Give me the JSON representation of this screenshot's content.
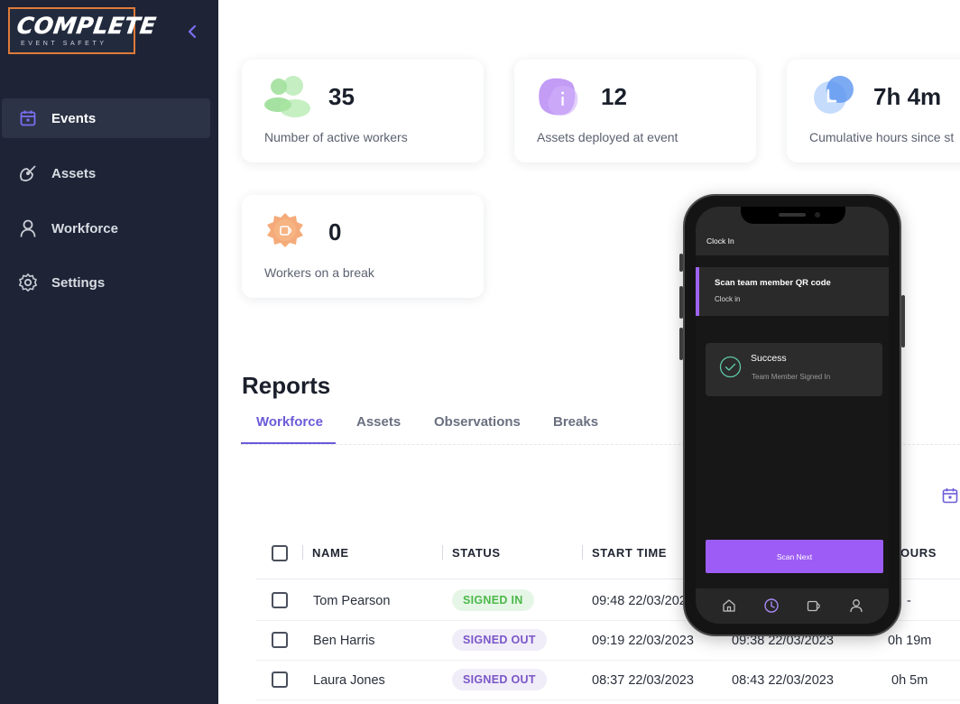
{
  "brand": {
    "name": "COMPLETE",
    "tagline": "EVENT SAFETY",
    "accent": "#e07a3a"
  },
  "sidebar": {
    "items": [
      {
        "label": "Events",
        "icon": "calendar-icon",
        "active": true
      },
      {
        "label": "Assets",
        "icon": "satellite-icon"
      },
      {
        "label": "Workforce",
        "icon": "user-icon"
      },
      {
        "label": "Settings",
        "icon": "gear-icon"
      }
    ]
  },
  "stats": [
    {
      "value": "35",
      "label": "Number of active workers",
      "icon": "workers-icon"
    },
    {
      "value": "12",
      "label": "Assets deployed at event",
      "icon": "info-icon"
    },
    {
      "value": "7h 4m",
      "label": "Cumulative hours since st",
      "icon": "clock-icon"
    },
    {
      "value": "0",
      "label": "Workers on a break",
      "icon": "coffee-icon"
    }
  ],
  "reports": {
    "title": "Reports",
    "tabs": [
      "Workforce",
      "Assets",
      "Observations",
      "Breaks"
    ],
    "active_tab": "Workforce",
    "columns": [
      "NAME",
      "STATUS",
      "START TIME",
      "OURS"
    ],
    "rows": [
      {
        "name": "Tom Pearson",
        "status": "SIGNED IN",
        "start": "09:48 22/03/2023",
        "end": "",
        "hours": "-"
      },
      {
        "name": "Ben Harris",
        "status": "SIGNED OUT",
        "start": "09:19 22/03/2023",
        "end": "09:38 22/03/2023",
        "hours": "0h 19m"
      },
      {
        "name": "Laura Jones",
        "status": "SIGNED OUT",
        "start": "08:37 22/03/2023",
        "end": "08:43 22/03/2023",
        "hours": "0h 5m"
      }
    ]
  },
  "phone": {
    "screen_title": "Clock In",
    "scan_title": "Scan team member QR code",
    "scan_sub": "Clock in",
    "success_title": "Success",
    "success_sub": "Team Member Signed In",
    "button": "Scan Next",
    "accent": "#9d5cf5",
    "tabbar": [
      "home-icon",
      "clock-icon",
      "coffee-icon",
      "user-icon"
    ]
  },
  "colors": {
    "sidebar_bg": "#1e2436",
    "tab_active": "#6a5cd8",
    "signed_in": "#4cb84a",
    "signed_out": "#7a56c8"
  }
}
